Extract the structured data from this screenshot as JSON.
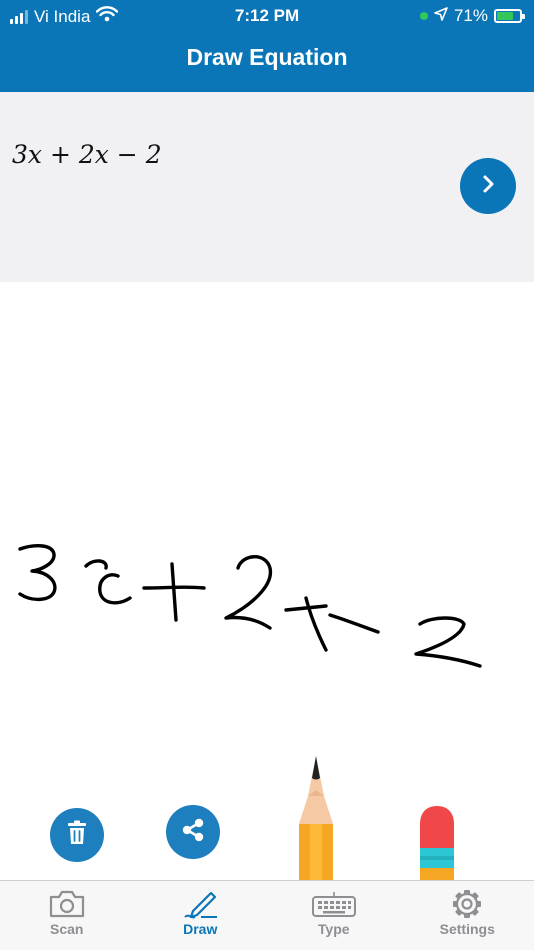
{
  "status_bar": {
    "carrier": "Vi India",
    "time": "7:12 PM",
    "battery": "71%",
    "battery_level": 0.71
  },
  "header": {
    "title": "Draw Equation"
  },
  "preview": {
    "equation": "3x + 2x − 2"
  },
  "colors": {
    "brand": "#0b76b7",
    "tab_inactive": "#8e8e93",
    "pencil": "#f5a623",
    "eraser": "#f04848"
  },
  "icons": [
    "signal-icon",
    "wifi-icon",
    "location-icon",
    "battery-icon",
    "chevron-right-icon",
    "trash-icon",
    "share-icon",
    "pencil-tool-icon",
    "eraser-tool-icon",
    "camera-icon",
    "pen-icon",
    "keyboard-icon",
    "gear-icon"
  ],
  "tabs": [
    {
      "label": "Scan",
      "icon": "camera-icon",
      "active": false
    },
    {
      "label": "Draw",
      "icon": "pen-icon",
      "active": true
    },
    {
      "label": "Type",
      "icon": "keyboard-icon",
      "active": false
    },
    {
      "label": "Settings",
      "icon": "gear-icon",
      "active": false
    }
  ]
}
